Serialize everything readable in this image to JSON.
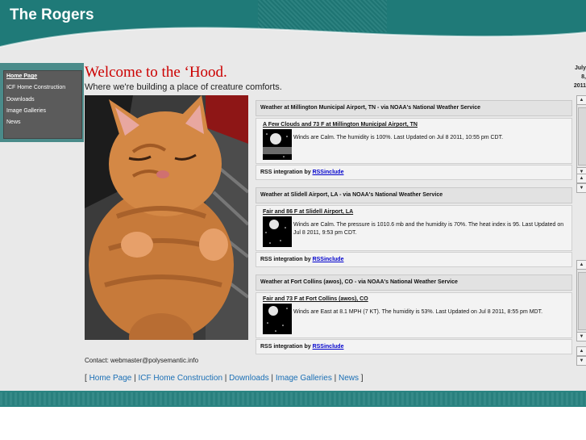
{
  "header": {
    "title": "The Rogers"
  },
  "sidebar": {
    "items": [
      {
        "label": "Home Page",
        "active": true
      },
      {
        "label": "ICF Home Construction",
        "active": false
      },
      {
        "label": "Downloads",
        "active": false
      },
      {
        "label": "Image Galleries",
        "active": false
      },
      {
        "label": "News",
        "active": false
      }
    ]
  },
  "main": {
    "title": "Welcome to the ‘Hood.",
    "subtitle": "Where we're building a place of creature comforts.",
    "date": [
      "July",
      "8,",
      "2011"
    ]
  },
  "weather": [
    {
      "header": "Weather at Millington Municipal Airport, TN - via NOAA's National Weather Service",
      "link": "A Few Clouds and 73 F at Millington Municipal Airport, TN",
      "text": "Winds are Calm. The humidity is 100%. Last Updated on Jul 8 2011, 10:55 pm CDT.",
      "footer_prefix": "RSS integration by ",
      "footer_link": "RSSinclude"
    },
    {
      "header": "Weather at Slidell Airport, LA - via NOAA's National Weather Service",
      "link": "Fair and 86 F at Slidell Airport, LA",
      "text": "Winds are Calm. The pressure is 1010.6 mb and the humidity is 70%. The heat index is 95. Last Updated on Jul 8 2011, 9:53 pm CDT.",
      "footer_prefix": "RSS integration by ",
      "footer_link": "RSSinclude"
    },
    {
      "header": "Weather at Fort Collins (awos), CO - via NOAA's National Weather Service",
      "link": "Fair and 73 F at Fort Collins (awos), CO",
      "text": "Winds are East at 8.1 MPH (7 KT). The humidity is 53%. Last Updated on Jul 8 2011, 8:55 pm MDT.",
      "footer_prefix": "RSS integration by ",
      "footer_link": "RSSinclude"
    }
  ],
  "contact": "Contact: webmaster@polysemantic.info",
  "footer_nav": {
    "open": "[ ",
    "sep": " | ",
    "close": " ]",
    "links": [
      "Home Page",
      "ICF Home Construction",
      "Downloads",
      "Image Galleries",
      "News"
    ]
  },
  "colors": {
    "header": "#1f7a78",
    "title_red": "#cc0000",
    "link_blue": "#1a6fb5"
  }
}
